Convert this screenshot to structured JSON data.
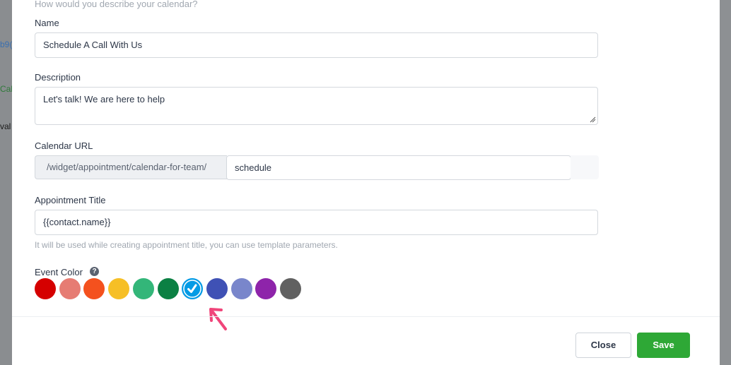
{
  "background": {
    "snippets": [
      "b9(",
      "Cal",
      "val"
    ]
  },
  "form": {
    "description_hint": "How would you describe your calendar?",
    "name": {
      "label": "Name",
      "value": "Schedule A Call With Us"
    },
    "description": {
      "label": "Description",
      "value": "Let's talk! We are here to help"
    },
    "calendar_url": {
      "label": "Calendar URL",
      "prefix": "/widget/appointment/calendar-for-team/",
      "value": "schedule"
    },
    "appointment_title": {
      "label": "Appointment Title",
      "value": "{{contact.name}}",
      "help": "It will be used while creating appointment title, you can use template parameters."
    },
    "event_color": {
      "label": "Event Color",
      "help_icon": "?",
      "selected_index": 6,
      "colors": [
        "#d50000",
        "#e67c73",
        "#f4511e",
        "#f6bf26",
        "#33b679",
        "#0b8043",
        "#039be5",
        "#3f51b5",
        "#7986cb",
        "#8e24aa",
        "#616161"
      ]
    }
  },
  "footer": {
    "close_label": "Close",
    "save_label": "Save"
  },
  "colors": {
    "save_button": "#2ea836",
    "annotation_arrow": "#f0457a"
  }
}
